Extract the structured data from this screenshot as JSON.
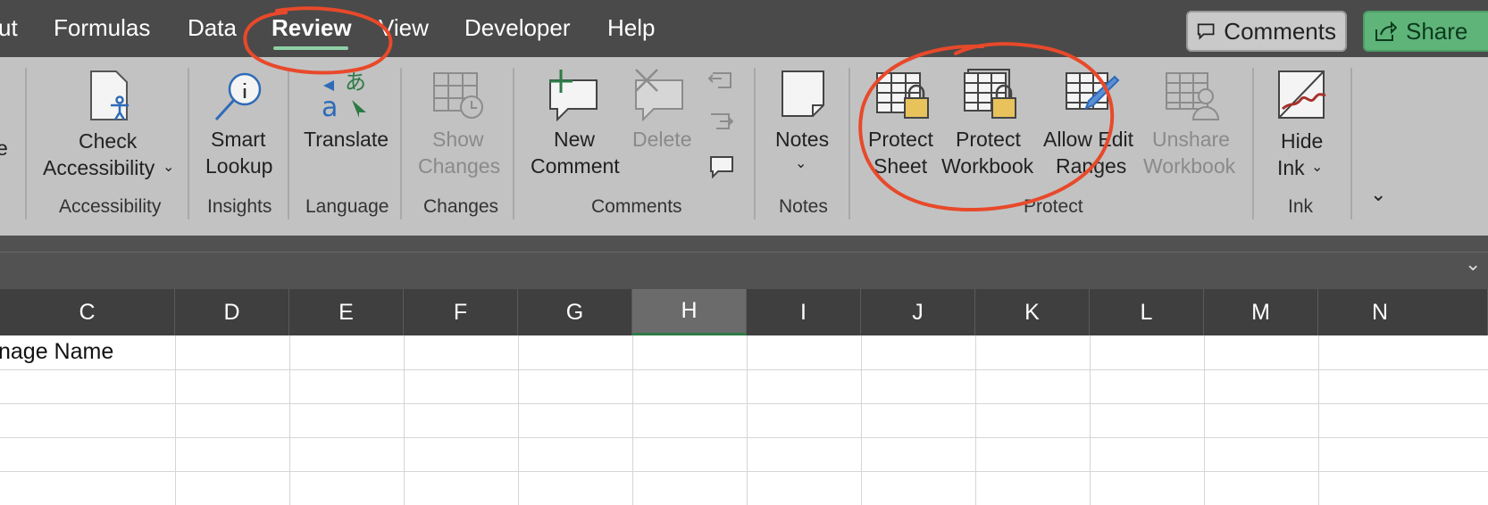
{
  "tabs": [
    {
      "label": "ut",
      "active": false
    },
    {
      "label": "Formulas",
      "active": false
    },
    {
      "label": "Data",
      "active": false
    },
    {
      "label": "Review",
      "active": true
    },
    {
      "label": "View",
      "active": false
    },
    {
      "label": "Developer",
      "active": false
    },
    {
      "label": "Help",
      "active": false
    }
  ],
  "header_buttons": {
    "comments": {
      "label": "Comments",
      "icon": "comment-icon"
    },
    "share": {
      "label": "Share",
      "icon": "share-icon"
    }
  },
  "ribbon": {
    "edge_fragment": "e",
    "buttons": {
      "check_accessibility": {
        "line1": "Check",
        "line2": "Accessibility",
        "icon": "accessibility-icon",
        "dropdown": true
      },
      "smart_lookup": {
        "line1": "Smart",
        "line2": "Lookup",
        "icon": "smart-lookup-icon"
      },
      "translate": {
        "line1": "Translate",
        "icon": "translate-icon"
      },
      "show_changes": {
        "line1": "Show",
        "line2": "Changes",
        "icon": "show-changes-icon",
        "disabled": true
      },
      "new_comment": {
        "line1": "New",
        "line2": "Comment",
        "icon": "new-comment-icon"
      },
      "delete": {
        "line1": "Delete",
        "icon": "delete-comment-icon",
        "disabled": true
      },
      "notes": {
        "line1": "Notes",
        "icon": "notes-icon",
        "dropdown": true
      },
      "protect_sheet": {
        "line1": "Protect",
        "line2": "Sheet",
        "icon": "protect-sheet-icon"
      },
      "protect_workbook": {
        "line1": "Protect",
        "line2": "Workbook",
        "icon": "protect-workbook-icon"
      },
      "allow_edit_ranges": {
        "line1": "Allow Edit",
        "line2": "Ranges",
        "icon": "allow-edit-ranges-icon"
      },
      "unshare_workbook": {
        "line1": "Unshare",
        "line2": "Workbook",
        "icon": "unshare-workbook-icon",
        "disabled": true
      },
      "hide_ink": {
        "line1": "Hide",
        "line2": "Ink",
        "icon": "hide-ink-icon",
        "dropdown": true
      }
    },
    "groups": {
      "accessibility": "Accessibility",
      "insights": "Insights",
      "language": "Language",
      "changes": "Changes",
      "comments": "Comments",
      "notes": "Notes",
      "protect": "Protect",
      "ink": "Ink"
    }
  },
  "columns": [
    "C",
    "D",
    "E",
    "F",
    "G",
    "H",
    "I",
    "J",
    "K",
    "L",
    "M",
    "N"
  ],
  "selected_column": "H",
  "cells": {
    "C1": "nage Name"
  },
  "colors": {
    "tabbar": "#4a4a4a",
    "ribbon": "#c2c2c2",
    "annotation": "#e8492a",
    "share_green": "#5fb47a",
    "active_tab_underline": "#8fd1a6"
  }
}
